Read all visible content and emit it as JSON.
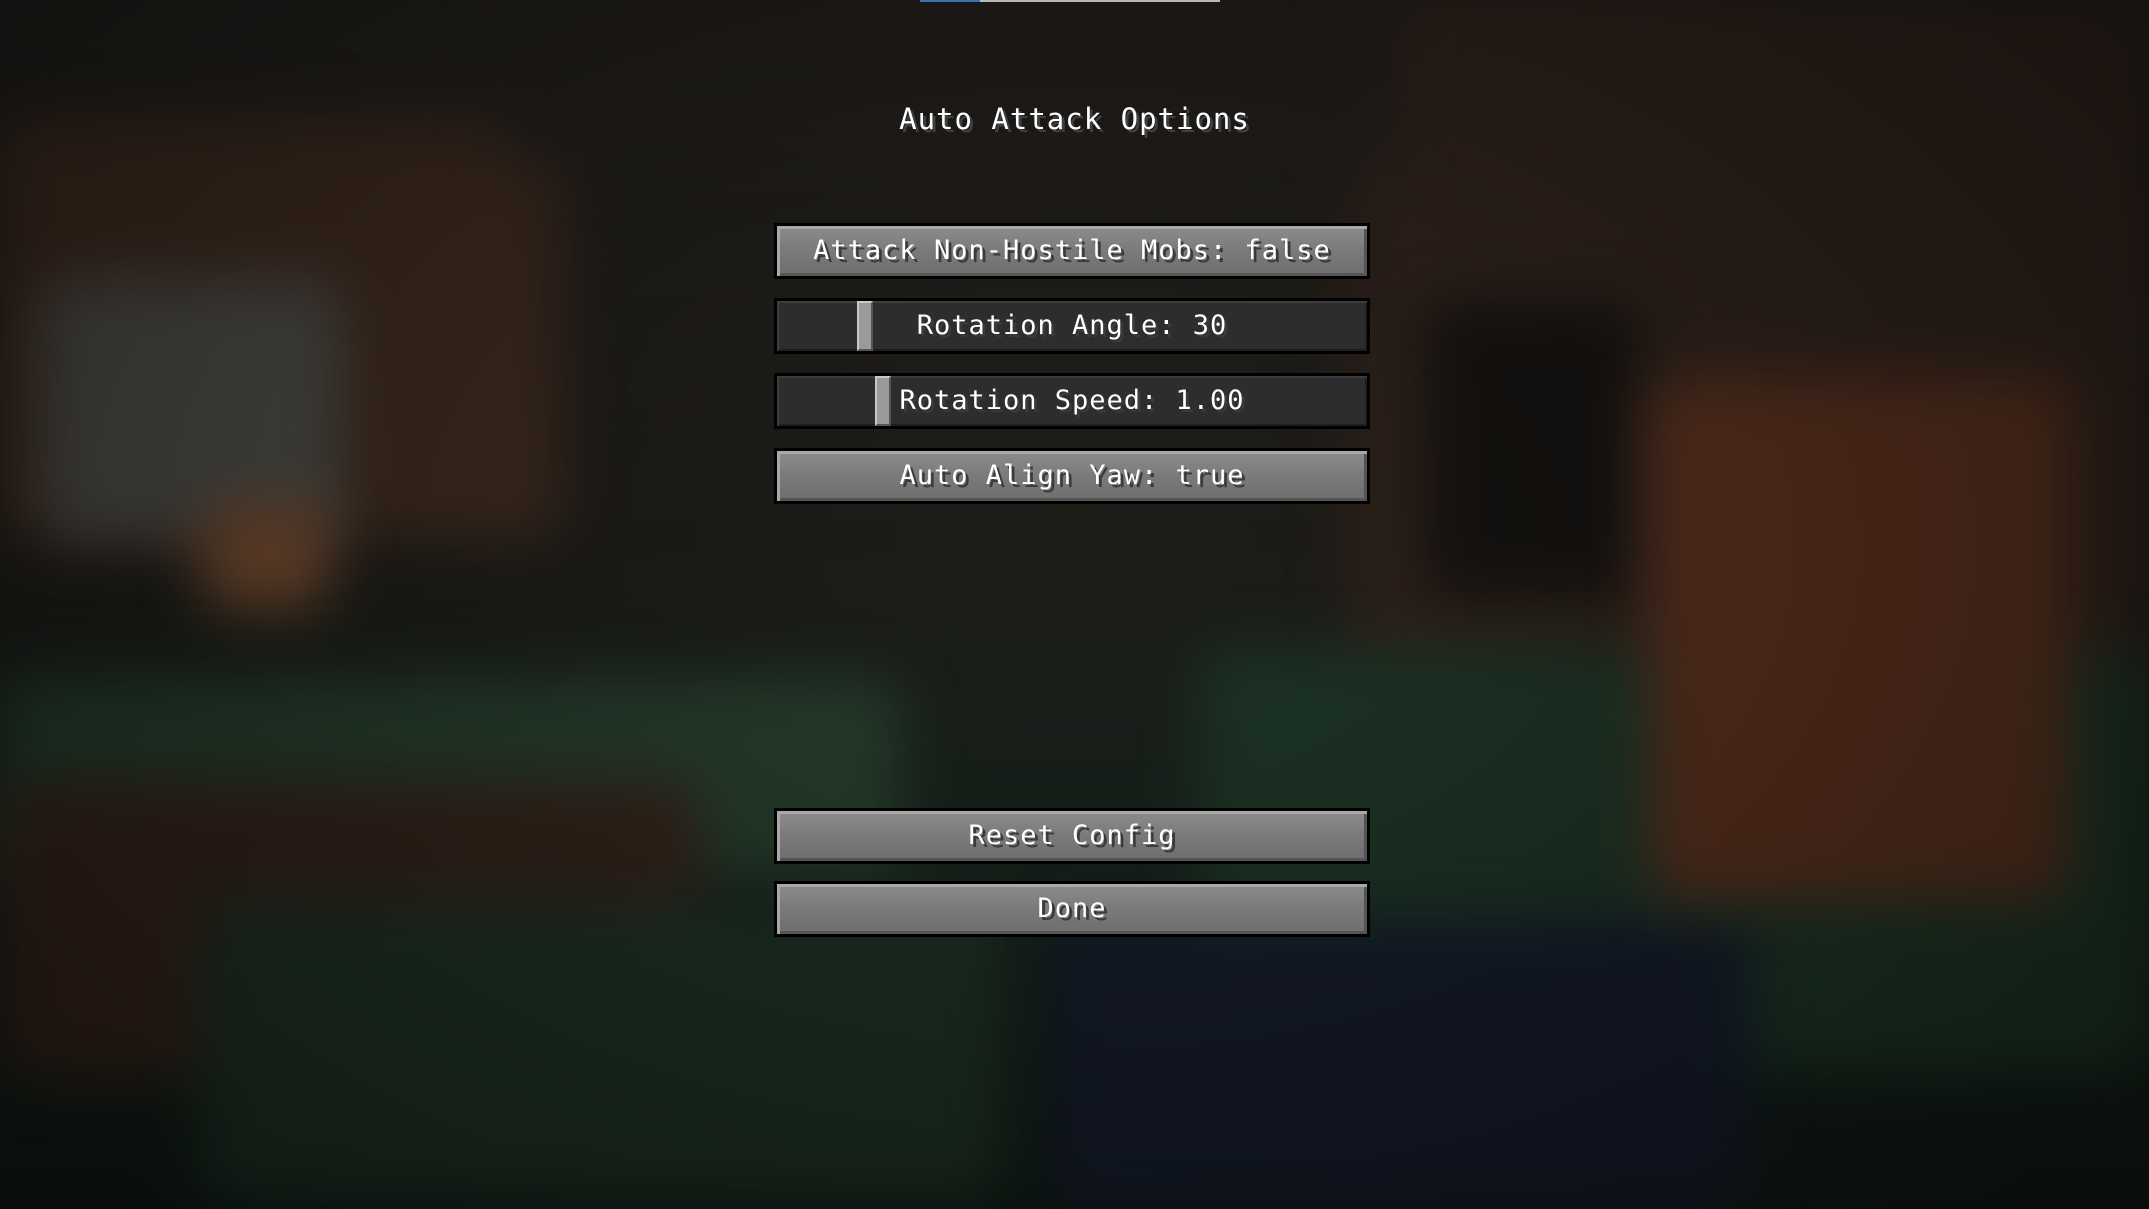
{
  "screen": {
    "title": "Auto Attack Options"
  },
  "options": {
    "attack_non_hostile": {
      "label": "Attack Non-Hostile Mobs: false"
    },
    "rotation_angle": {
      "label": "Rotation Angle: 30",
      "value": 30,
      "level_fraction": 0.14
    },
    "rotation_speed": {
      "label": "Rotation Speed: 1.00",
      "value": 1.0,
      "level_fraction": 0.17
    },
    "auto_align_yaw": {
      "label": "Auto Align Yaw: true"
    }
  },
  "footer": {
    "reset_label": "Reset Config",
    "done_label": "Done"
  },
  "colors": {
    "button_face": "#7a7a7a",
    "slider_track": "#2d2d2d",
    "text": "#ffffff"
  }
}
